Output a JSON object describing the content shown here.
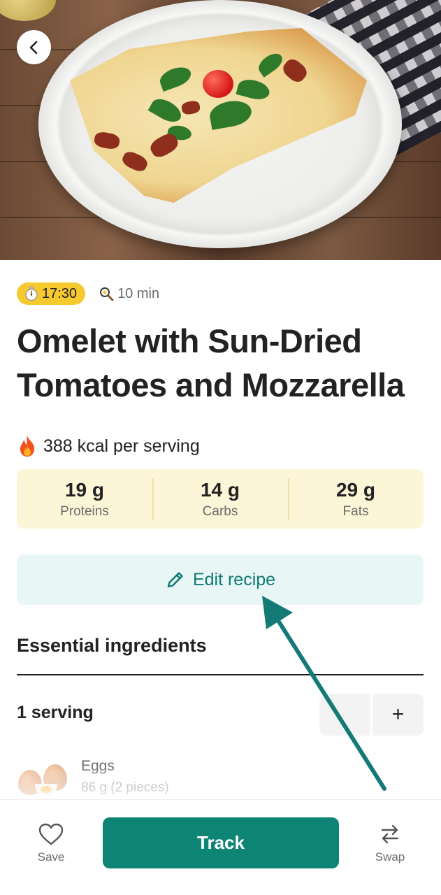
{
  "header": {
    "back_icon": "chevron-left-icon"
  },
  "recipe": {
    "time_badge": "17:30",
    "time_icon": "stopwatch-icon",
    "cook_time": "10 min",
    "cook_icon": "frying-pan-icon",
    "title": "Omelet with Sun-Dried Tomatoes and Mozzarella",
    "kcal_text": "388 kcal per serving",
    "kcal_icon": "fire-icon"
  },
  "macros": [
    {
      "value": "19 g",
      "label": "Proteins"
    },
    {
      "value": "14 g",
      "label": "Carbs"
    },
    {
      "value": "29 g",
      "label": "Fats"
    }
  ],
  "edit": {
    "label": "Edit recipe",
    "icon": "pencil-icon"
  },
  "ingredients_section": {
    "title": "Essential ingredients",
    "servings": "1 serving",
    "plus": "+",
    "items": [
      {
        "name": "Eggs",
        "amount": "86 g (2 pieces)"
      }
    ]
  },
  "bottom_bar": {
    "save_label": "Save",
    "track_label": "Track",
    "swap_label": "Swap"
  },
  "colors": {
    "accent": "#0d8474",
    "badge": "#f6c92e",
    "macros_bg": "#fdf5d8",
    "edit_bg": "#e8f6f5",
    "arrow": "#137a76"
  }
}
